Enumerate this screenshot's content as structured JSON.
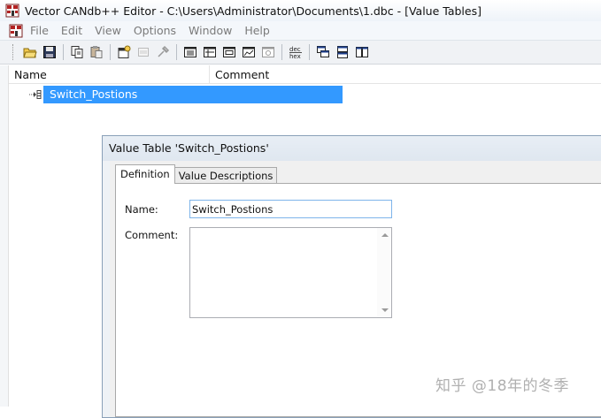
{
  "window": {
    "title": "Vector CANdb++ Editor - C:\\Users\\Administrator\\Documents\\1.dbc - [Value Tables]"
  },
  "menubar": {
    "items": [
      "File",
      "Edit",
      "View",
      "Options",
      "Window",
      "Help"
    ]
  },
  "toolbar": {
    "icons": [
      "open-folder-icon",
      "save-icon",
      "copy-icon",
      "paste-icon",
      "properties-icon",
      "disabled-icon",
      "tools-icon",
      "view-list-icon",
      "view-details-icon",
      "view-message-icon",
      "view-signal-icon",
      "view-network-icon",
      "dec-hex-icon",
      "cascade-icon",
      "tile-horizontal-icon",
      "tile-vertical-icon"
    ],
    "dec_hex_top": "dec",
    "dec_hex_bottom": "hex"
  },
  "list": {
    "columns": [
      "Name",
      "Comment"
    ],
    "rows": [
      {
        "name": "Switch_Postions",
        "comment": ""
      }
    ]
  },
  "dialog": {
    "title": "Value Table 'Switch_Postions'",
    "tabs": [
      "Definition",
      "Value Descriptions"
    ],
    "active_tab": "Definition",
    "name_label": "Name:",
    "name_value": "Switch_Postions",
    "comment_label": "Comment:",
    "comment_value": ""
  },
  "watermark": "知乎 @18年的冬季",
  "colors": {
    "selection": "#3399ff",
    "focus_border": "#7eb4ea"
  }
}
